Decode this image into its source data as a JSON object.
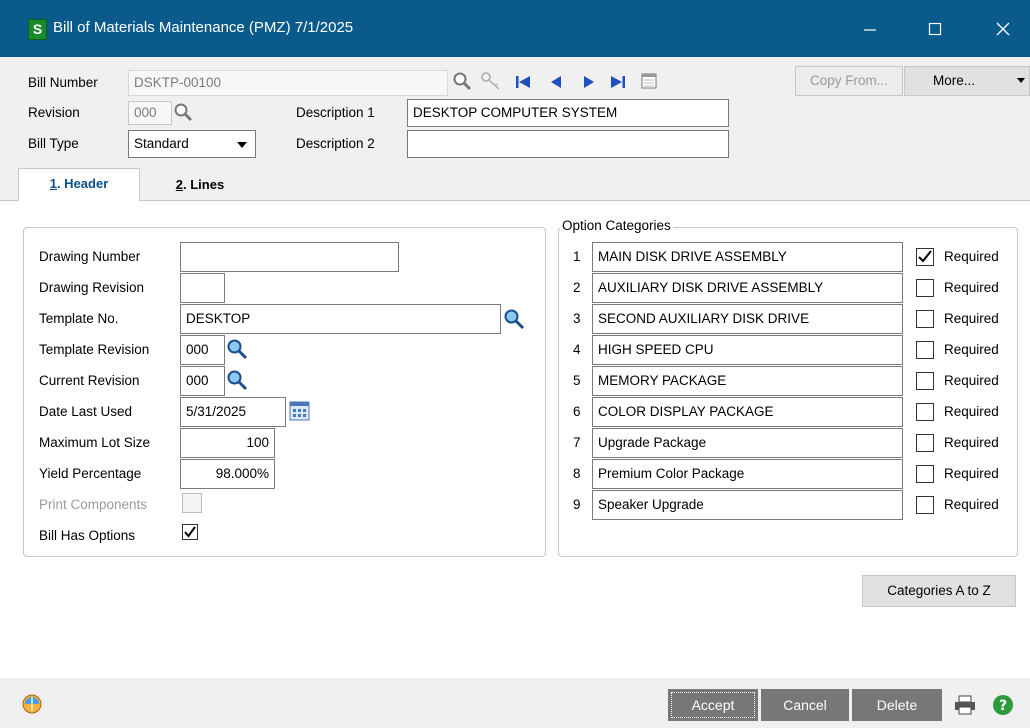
{
  "window": {
    "title": "Bill of Materials Maintenance (PMZ) 7/1/2025",
    "app_icon": "S"
  },
  "header": {
    "bill_number_label": "Bill Number",
    "bill_number": "DSKTP-00100",
    "revision_label": "Revision",
    "revision": "000",
    "bill_type_label": "Bill Type",
    "bill_type": "Standard",
    "description1_label": "Description 1",
    "description1": "DESKTOP COMPUTER SYSTEM",
    "description2_label": "Description 2",
    "description2": "",
    "copy_from_label": "Copy From...",
    "more_label": "More..."
  },
  "tabs": [
    {
      "num": "1",
      "label": ". Header"
    },
    {
      "num": "2",
      "label": ". Lines"
    }
  ],
  "form": {
    "drawing_number_label": "Drawing Number",
    "drawing_number": "",
    "drawing_revision_label": "Drawing Revision",
    "drawing_revision": "",
    "template_no_label": "Template No.",
    "template_no": "DESKTOP",
    "template_revision_label": "Template Revision",
    "template_revision": "000",
    "current_revision_label": "Current Revision",
    "current_revision": "000",
    "date_last_used_label": "Date Last Used",
    "date_last_used": "5/31/2025",
    "max_lot_size_label": "Maximum Lot Size",
    "max_lot_size": "100",
    "yield_label": "Yield Percentage",
    "yield": "98.000%",
    "print_components_label": "Print Components",
    "bill_has_options_label": "Bill Has Options"
  },
  "option_categories": {
    "title": "Option Categories",
    "required_label": "Required",
    "items": [
      {
        "num": "1",
        "name": "MAIN DISK DRIVE ASSEMBLY",
        "required": true
      },
      {
        "num": "2",
        "name": "AUXILIARY DISK DRIVE ASSEMBLY",
        "required": false
      },
      {
        "num": "3",
        "name": "SECOND AUXILIARY DISK DRIVE",
        "required": false
      },
      {
        "num": "4",
        "name": "HIGH SPEED CPU",
        "required": false
      },
      {
        "num": "5",
        "name": "MEMORY PACKAGE",
        "required": false
      },
      {
        "num": "6",
        "name": "COLOR DISPLAY PACKAGE",
        "required": false
      },
      {
        "num": "7",
        "name": "Upgrade Package",
        "required": false
      },
      {
        "num": "8",
        "name": "Premium Color Package",
        "required": false
      },
      {
        "num": "9",
        "name": "Speaker Upgrade",
        "required": false
      }
    ],
    "categories_button": "Categories A to Z"
  },
  "footer": {
    "accept": "Accept",
    "cancel": "Cancel",
    "delete": "Delete"
  },
  "colors": {
    "titlebar": "#0b5a8c",
    "footer_button": "#777777",
    "active_tab_text": "#0b4f8c"
  }
}
